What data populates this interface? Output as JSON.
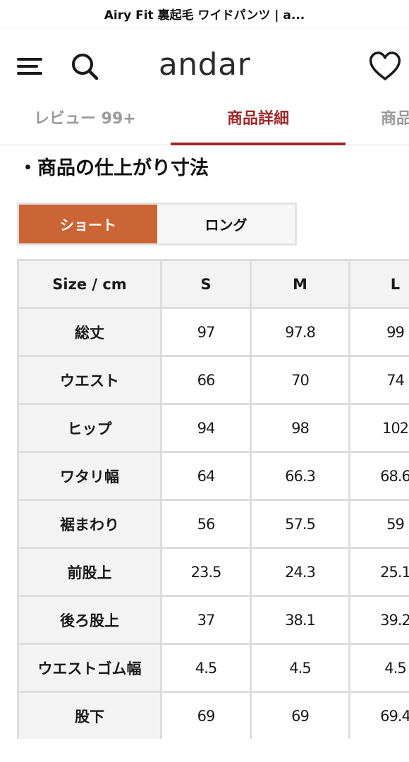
{
  "topbar": {
    "title": "Airy Fit 裏起毛 ワイドパンツ | a..."
  },
  "header": {
    "logo": "andar",
    "icons": {
      "menu": "hamburger-menu-icon",
      "search": "search-icon",
      "wishlist": "heart-icon"
    }
  },
  "tabs": [
    {
      "label": "レビュー 99+",
      "active": false
    },
    {
      "label": "商品詳細",
      "active": true
    },
    {
      "label": "商品",
      "active": false
    }
  ],
  "section": {
    "title": "・商品の仕上がり寸法"
  },
  "size_toggle": [
    {
      "label": "ショート",
      "selected": true
    },
    {
      "label": "ロング",
      "selected": false
    }
  ],
  "colors": {
    "accent": "#9d2a2a",
    "toggle_active": "#cc6535",
    "table_header_bg": "#f3f3f3",
    "table_border": "#dddddd"
  },
  "size_table": {
    "headers": [
      "Size / cm",
      "S",
      "M",
      "L"
    ],
    "rows": [
      {
        "label": "総丈",
        "values": [
          "97",
          "97.8",
          "99"
        ]
      },
      {
        "label": "ウエスト",
        "values": [
          "66",
          "70",
          "74"
        ]
      },
      {
        "label": "ヒップ",
        "values": [
          "94",
          "98",
          "102"
        ]
      },
      {
        "label": "ワタリ幅",
        "values": [
          "64",
          "66.3",
          "68.6"
        ]
      },
      {
        "label": "裾まわり",
        "values": [
          "56",
          "57.5",
          "59"
        ]
      },
      {
        "label": "前股上",
        "values": [
          "23.5",
          "24.3",
          "25.1"
        ]
      },
      {
        "label": "後ろ股上",
        "values": [
          "37",
          "38.1",
          "39.2"
        ]
      },
      {
        "label": "ウエストゴム幅",
        "values": [
          "4.5",
          "4.5",
          "4.5"
        ]
      },
      {
        "label": "股下",
        "values": [
          "69",
          "69",
          "69.4"
        ]
      }
    ]
  }
}
